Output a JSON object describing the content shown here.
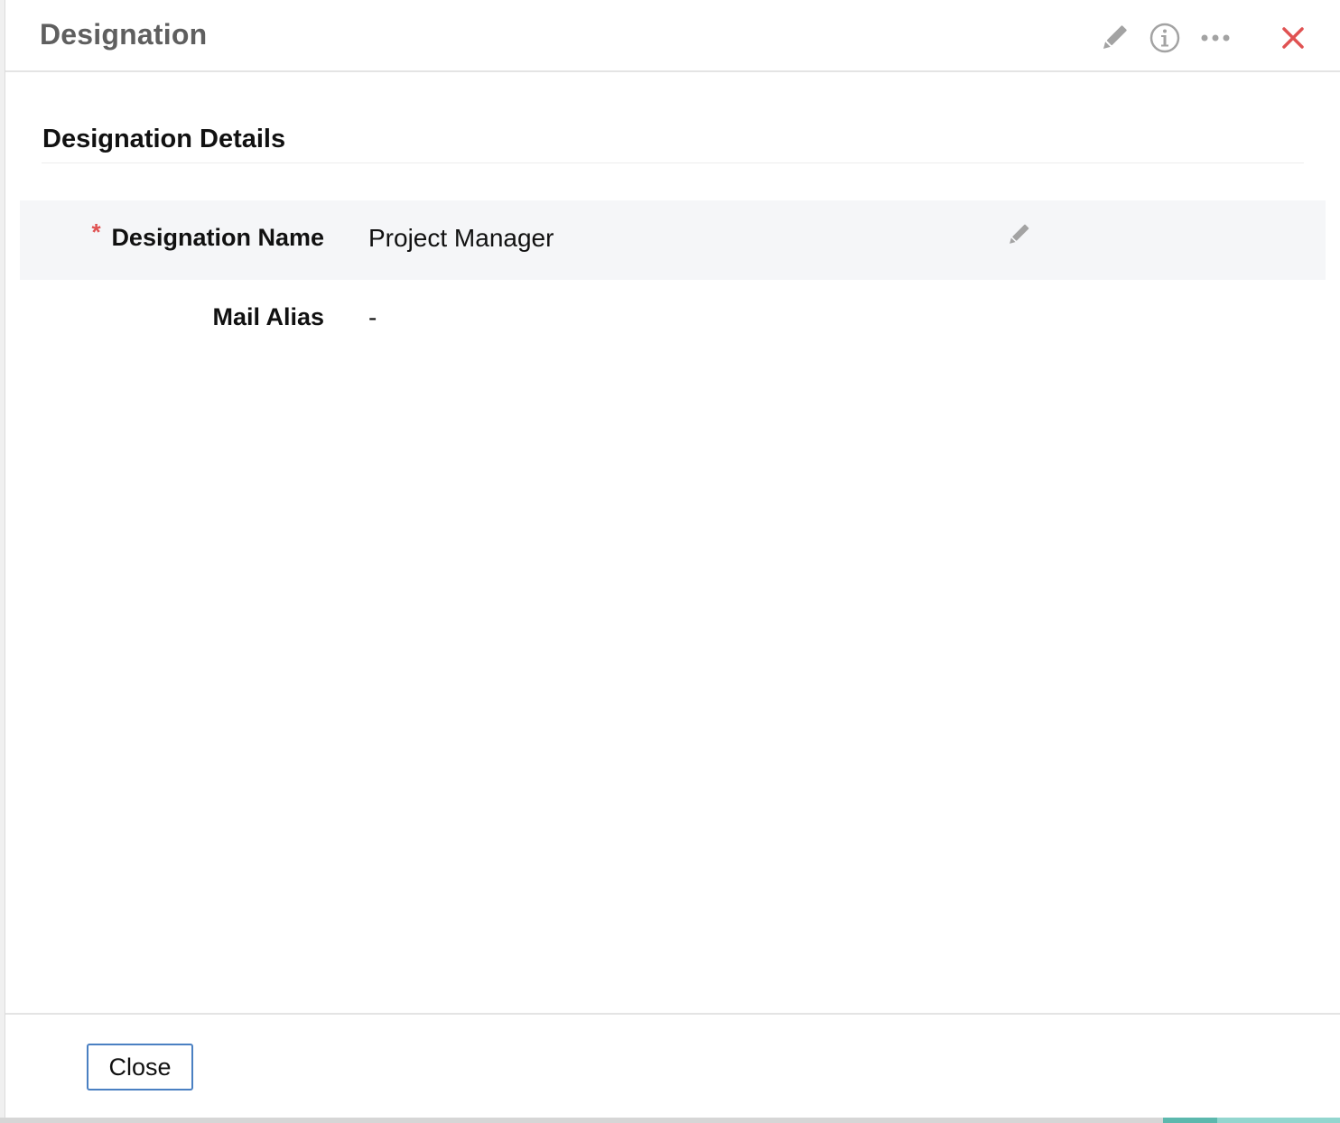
{
  "header": {
    "title": "Designation",
    "actions": [
      {
        "icon": "pencil-icon",
        "color": "#9b9b9b"
      },
      {
        "icon": "info-icon",
        "color": "#9b9b9b"
      },
      {
        "icon": "more-icon",
        "color": "#9b9b9b"
      },
      {
        "icon": "close-icon",
        "color": "#e05252"
      }
    ]
  },
  "section": {
    "title": "Designation Details"
  },
  "fields": [
    {
      "label": "Designation Name",
      "value": "Project Manager",
      "required": true,
      "required_mark": "*",
      "editable": true
    },
    {
      "label": "Mail Alias",
      "value": "-",
      "required": false,
      "editable": false
    }
  ],
  "footer": {
    "close_label": "Close"
  },
  "colors": {
    "accent_border": "#4a80c2",
    "required": "#e05252",
    "row_shade": "#f5f6f8",
    "bottom_accent": "#5cb8ad"
  }
}
